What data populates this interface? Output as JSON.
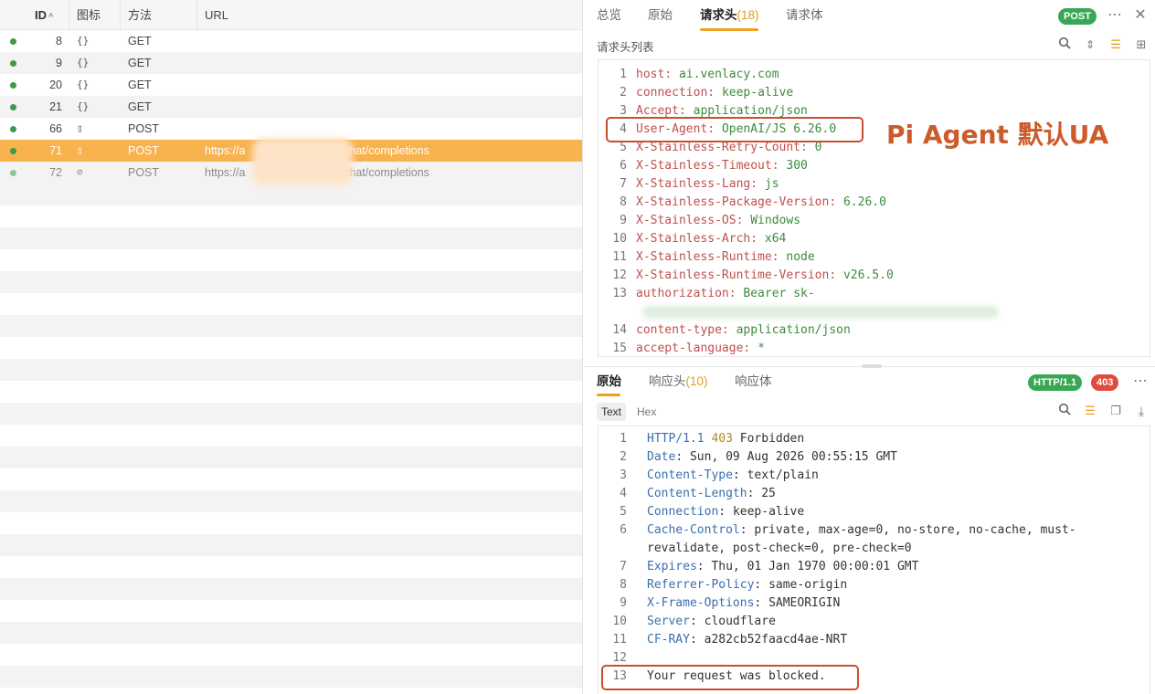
{
  "list": {
    "columns": {
      "id": "ID",
      "icon": "图标",
      "method": "方法",
      "url": "URL"
    },
    "rows": [
      {
        "id": "8",
        "icon": "{}",
        "method": "GET",
        "url": ""
      },
      {
        "id": "9",
        "icon": "{}",
        "method": "GET",
        "url": ""
      },
      {
        "id": "20",
        "icon": "{}",
        "method": "GET",
        "url": ""
      },
      {
        "id": "21",
        "icon": "{}",
        "method": "GET",
        "url": ""
      },
      {
        "id": "66",
        "icon": "▯",
        "method": "POST",
        "url": ""
      },
      {
        "id": "71",
        "icon": "▯",
        "method": "POST",
        "url": "https://a                              /chat/completions"
      },
      {
        "id": "72",
        "icon": "⊘",
        "method": "POST",
        "url": "https://a                              /chat/completions"
      }
    ]
  },
  "request_panel": {
    "tabs": [
      {
        "label": "总览"
      },
      {
        "label": "原始"
      },
      {
        "label": "请求头",
        "count": "(18)"
      },
      {
        "label": "请求体"
      }
    ],
    "method_badge": "POST",
    "section_title": "请求头列表",
    "headers": [
      {
        "n": "1",
        "k": "host",
        "v": "ai.venlacy.com"
      },
      {
        "n": "2",
        "k": "connection",
        "v": "keep-alive"
      },
      {
        "n": "3",
        "k": "Accept",
        "v": "application/json"
      },
      {
        "n": "4",
        "k": "User-Agent",
        "v": "OpenAI/JS 6.26.0"
      },
      {
        "n": "5",
        "k": "X-Stainless-Retry-Count",
        "v": "0"
      },
      {
        "n": "6",
        "k": "X-Stainless-Timeout",
        "v": "300"
      },
      {
        "n": "7",
        "k": "X-Stainless-Lang",
        "v": "js"
      },
      {
        "n": "8",
        "k": "X-Stainless-Package-Version",
        "v": "6.26.0"
      },
      {
        "n": "9",
        "k": "X-Stainless-OS",
        "v": "Windows"
      },
      {
        "n": "10",
        "k": "X-Stainless-Arch",
        "v": "x64"
      },
      {
        "n": "11",
        "k": "X-Stainless-Runtime",
        "v": "node"
      },
      {
        "n": "12",
        "k": "X-Stainless-Runtime-Version",
        "v": "v26.5.0"
      },
      {
        "n": "13",
        "k": "authorization",
        "v": "Bearer sk-"
      },
      {
        "n": "14",
        "k": "content-type",
        "v": "application/json"
      },
      {
        "n": "15",
        "k": "accept-language",
        "v": "*"
      }
    ],
    "annotation": "Pi Agent 默认UA"
  },
  "response_panel": {
    "tabs": [
      {
        "label": "原始"
      },
      {
        "label": "响应头",
        "count": "(10)"
      },
      {
        "label": "响应体"
      }
    ],
    "protocol_badge": "HTTP/1.1",
    "status_badge": "403",
    "view_modes": [
      "Text",
      "Hex"
    ],
    "status_line": {
      "proto": "HTTP/1.1",
      "code": "403",
      "text": "Forbidden"
    },
    "headers": [
      {
        "n": "2",
        "k": "Date",
        "v": "Sun, 09 Aug 2026 00:55:15 GMT"
      },
      {
        "n": "3",
        "k": "Content-Type",
        "v": "text/plain"
      },
      {
        "n": "4",
        "k": "Content-Length",
        "v": "25"
      },
      {
        "n": "5",
        "k": "Connection",
        "v": "keep-alive"
      },
      {
        "n": "6",
        "k": "Cache-Control",
        "v": "private, max-age=0, no-store, no-cache, must-",
        "cont": "revalidate, post-check=0, pre-check=0"
      },
      {
        "n": "7",
        "k": "Expires",
        "v": "Thu, 01 Jan 1970 00:00:01 GMT"
      },
      {
        "n": "8",
        "k": "Referrer-Policy",
        "v": "same-origin"
      },
      {
        "n": "9",
        "k": "X-Frame-Options",
        "v": "SAMEORIGIN"
      },
      {
        "n": "10",
        "k": "Server",
        "v": "cloudflare"
      },
      {
        "n": "11",
        "k": "CF-RAY",
        "v": "a282cb52faacd4ae-NRT"
      }
    ],
    "body_lines": [
      {
        "n": "12",
        "text": ""
      },
      {
        "n": "13",
        "text": "Your request was blocked."
      }
    ]
  },
  "colors": {
    "accent": "#f0a020",
    "selected_row": "#f8b24e",
    "success": "#3aa757",
    "error": "#e24a3b",
    "annotation": "#cc5a2a"
  }
}
